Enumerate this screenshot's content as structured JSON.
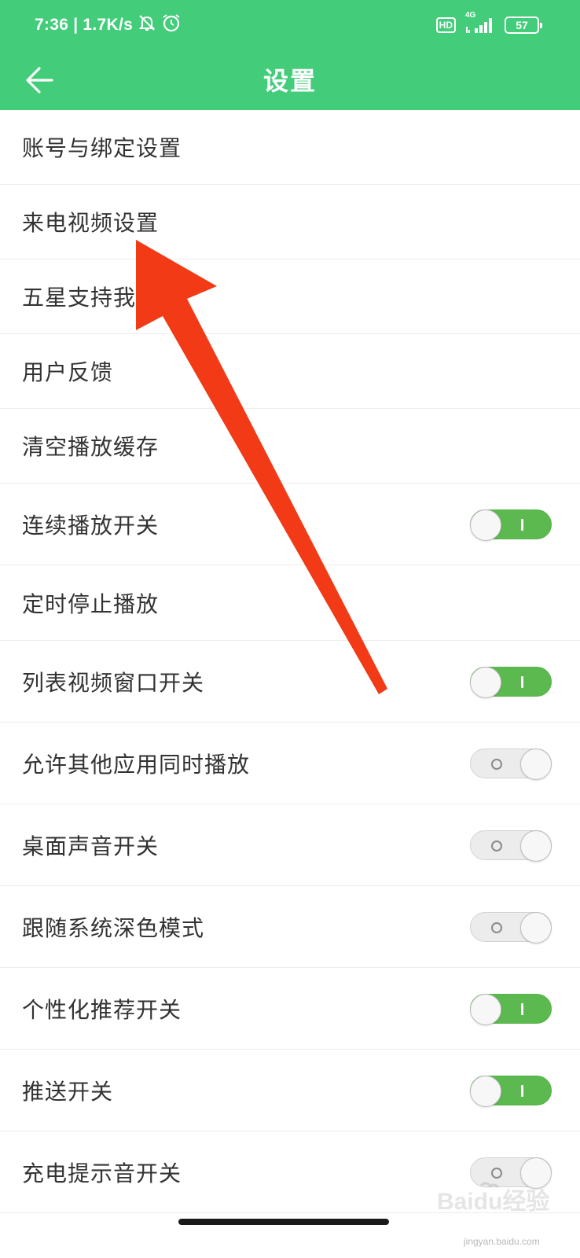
{
  "status_bar": {
    "time": "7:36",
    "separator": "|",
    "speed": "1.7K/s",
    "hd": "HD",
    "network": "4G",
    "battery": "57"
  },
  "header": {
    "title": "设置"
  },
  "settings": [
    {
      "label": "账号与绑定设置",
      "toggle": null
    },
    {
      "label": "来电视频设置",
      "toggle": null
    },
    {
      "label": "五星支持我",
      "toggle": null
    },
    {
      "label": "用户反馈",
      "toggle": null
    },
    {
      "label": "清空播放缓存",
      "toggle": null
    },
    {
      "label": "连续播放开关",
      "toggle": "on"
    },
    {
      "label": "定时停止播放",
      "toggle": null
    },
    {
      "label": "列表视频窗口开关",
      "toggle": "on"
    },
    {
      "label": "允许其他应用同时播放",
      "toggle": "off"
    },
    {
      "label": "桌面声音开关",
      "toggle": "off"
    },
    {
      "label": "跟随系统深色模式",
      "toggle": "off"
    },
    {
      "label": "个性化推荐开关",
      "toggle": "on"
    },
    {
      "label": "推送开关",
      "toggle": "on"
    },
    {
      "label": "充电提示音开关",
      "toggle": "off"
    }
  ],
  "watermark": {
    "brand": "Baidu经验",
    "url": "jingyan.baidu.com"
  },
  "colors": {
    "header": "#43cc7a",
    "toggle_on": "#5cb94f",
    "annotation_arrow": "#f23a16"
  }
}
